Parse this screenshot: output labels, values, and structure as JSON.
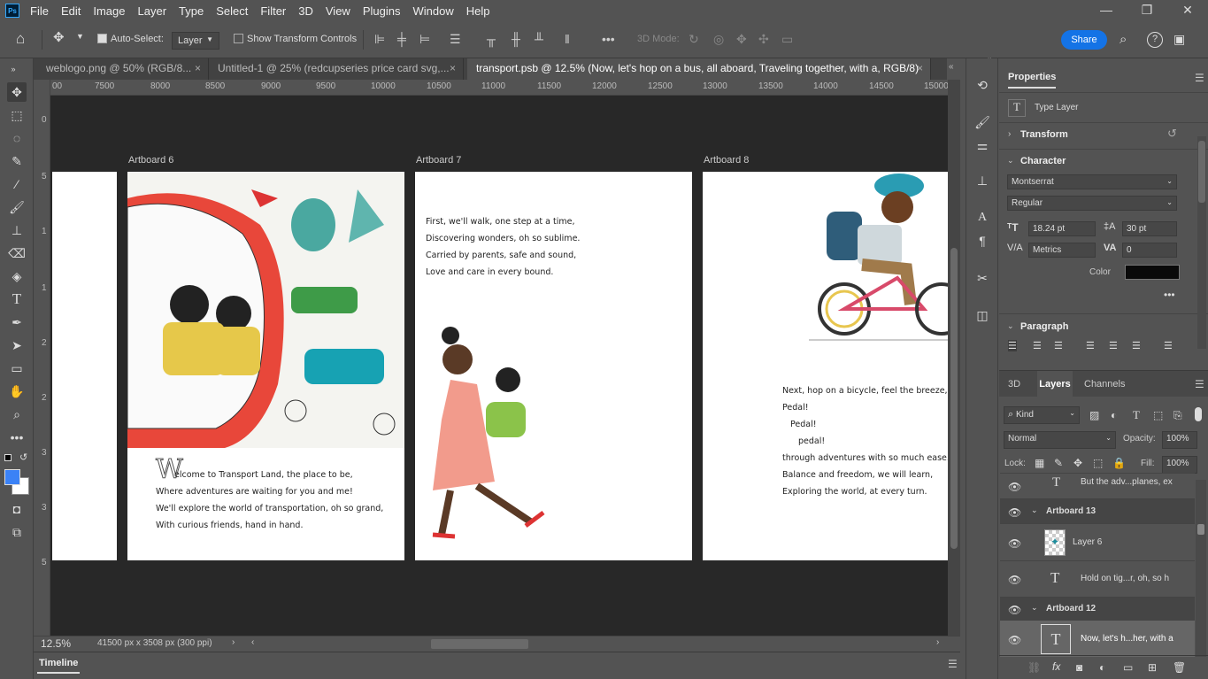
{
  "menu": {
    "logo": "Ps",
    "items": [
      "File",
      "Edit",
      "Image",
      "Layer",
      "Type",
      "Select",
      "Filter",
      "3D",
      "View",
      "Plugins",
      "Window",
      "Help"
    ]
  },
  "options": {
    "auto_select": "Auto-Select:",
    "layer_select": "Layer",
    "show_transform": "Show Transform Controls",
    "mode_3d": "3D Mode:",
    "share": "Share"
  },
  "tabs": [
    {
      "label": "weblogo.png @ 50% (RGB/8...",
      "close": "×"
    },
    {
      "label": "Untitled-1 @ 25% (redcupseries price card svg,...",
      "close": "×"
    },
    {
      "label": "transport.psb @ 12.5% (Now, let's hop on a bus, all aboard, Traveling together, with a, RGB/8)",
      "close": "×"
    }
  ],
  "ruler": {
    "h": [
      "00",
      "7500",
      "8000",
      "8500",
      "9000",
      "9500",
      "10000",
      "10500",
      "11000",
      "11500",
      "12000",
      "12500",
      "13000",
      "13500",
      "14000",
      "14500",
      "15000"
    ],
    "v": [
      "0",
      "5",
      "1",
      "0",
      "1",
      "5",
      "2",
      "0",
      "2",
      "5",
      "3",
      "0",
      "3",
      "5"
    ]
  },
  "artboards": {
    "a6": {
      "title": "Artboard 6",
      "drop_cap": "W",
      "lines": [
        "elcome to Transport Land, the place to be,",
        "Where adventures are waiting for you and me!",
        "We'll explore the world of transportation, oh so grand,",
        "With curious friends, hand in hand."
      ]
    },
    "a7": {
      "title": "Artboard 7",
      "lines": [
        "First, we'll walk, one step at a time,",
        "Discovering wonders, oh so sublime.",
        "Carried by parents, safe and sound,",
        "Love and care in every bound."
      ]
    },
    "a8": {
      "title": "Artboard 8",
      "lines": [
        "Next, hop on a bicycle, feel the breeze,",
        "Pedal!",
        "Pedal!",
        "pedal!",
        "through adventures with so much ease.",
        "Balance and freedom, we will learn,",
        "Exploring the world, at every turn."
      ]
    }
  },
  "status": {
    "zoom": "12.5%",
    "doc_size": "41500 px x 3508 px (300 ppi)",
    "timeline": "Timeline"
  },
  "properties": {
    "title": "Properties",
    "layer_type": "Type Layer",
    "transform": "Transform",
    "character": "Character",
    "font": "Montserrat",
    "style": "Regular",
    "size": "18.24 pt",
    "leading": "30 pt",
    "kerning": "Metrics",
    "tracking": "0",
    "color_label": "Color",
    "color": "#0a0a0a",
    "paragraph": "Paragraph"
  },
  "layers": {
    "tabs": [
      "3D",
      "Layers",
      "Channels"
    ],
    "kind": "Kind",
    "blend": "Normal",
    "opacity_label": "Opacity:",
    "opacity": "100%",
    "lock_label": "Lock:",
    "fill_label": "Fill:",
    "fill": "100%",
    "rows": [
      {
        "name": "But the adv...planes, ex",
        "type": "text"
      },
      {
        "name": "Artboard 13",
        "type": "group"
      },
      {
        "name": "Layer 6",
        "type": "image"
      },
      {
        "name": "Hold on tig...r, oh, so h",
        "type": "text"
      },
      {
        "name": "Artboard 12",
        "type": "group"
      },
      {
        "name": "Now, let's h...her, with a",
        "type": "text"
      }
    ]
  }
}
